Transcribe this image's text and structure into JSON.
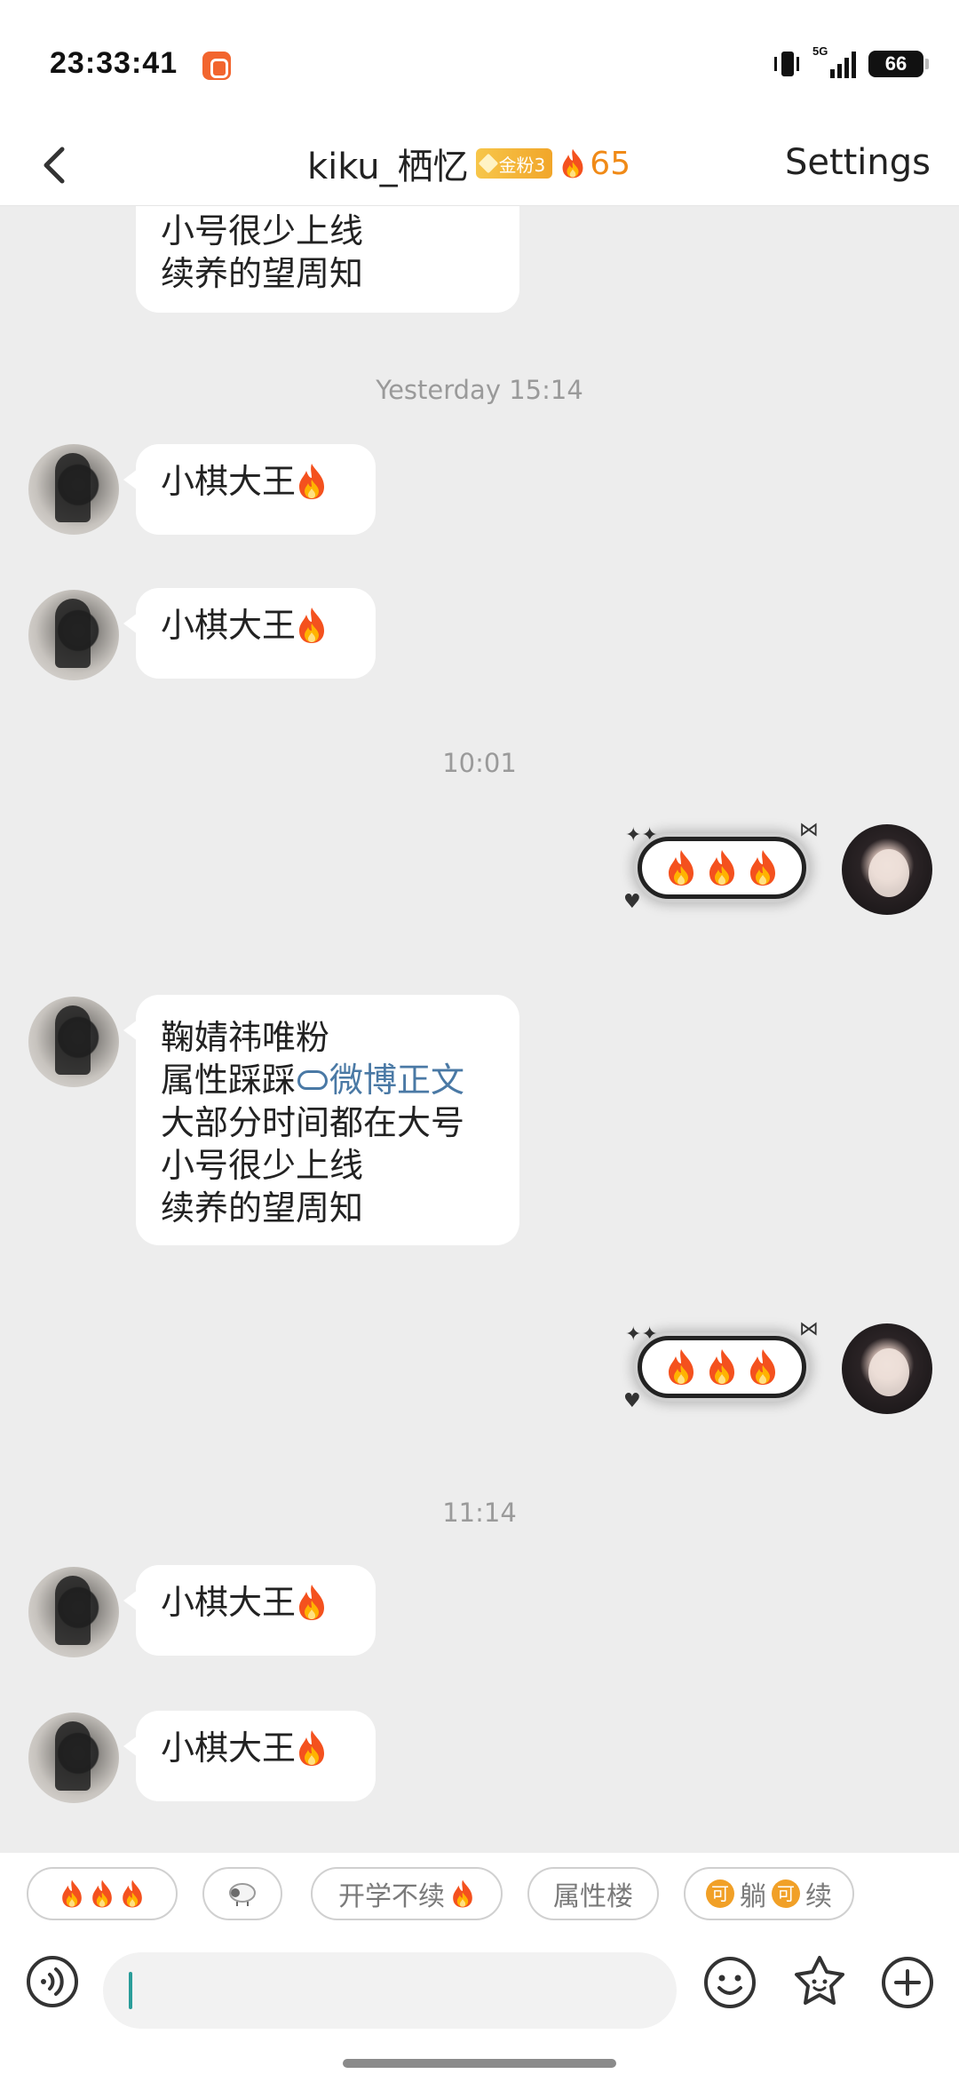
{
  "status_bar": {
    "time": "23:33:41",
    "network": "5G",
    "battery": "66"
  },
  "header": {
    "title": "kiku_栖忆",
    "fan_badge": "金粉3",
    "fire_score": "65",
    "settings_label": "Settings"
  },
  "messages": {
    "top_partial": {
      "line1": "小号很少上线",
      "line2": "续养的望周知"
    },
    "ts1": "Yesterday 15:14",
    "m1": "小棋大王",
    "m2": "小棋大王",
    "ts2": "10:01",
    "m4": {
      "line1": "鞠婧祎唯粉",
      "line2_prefix": "属性踩踩",
      "line2_link": "微博正文",
      "line3": "大部分时间都在大号",
      "line4": "小号很少上线",
      "line5": "续养的望周知"
    },
    "ts3": "11:14",
    "m6": "小棋大王",
    "m7": "小棋大王"
  },
  "quick_replies": {
    "chip2_icon": "sheep-icon",
    "chip3": "开学不续",
    "chip4": "属性楼",
    "chip5_a": "可",
    "chip5_b": "躺",
    "chip5_c": "可",
    "chip5_d": "续"
  },
  "input": {
    "value": "",
    "placeholder": ""
  },
  "icons": {
    "back": "chevron-left-icon",
    "voice": "voice-icon",
    "emoji": "smiley-icon",
    "sticker": "sticker-icon",
    "plus": "plus-icon",
    "fire": "fire-icon"
  },
  "colors": {
    "accent_fire": "#f08a17",
    "link": "#4a79a5",
    "badge": "#f1a62a",
    "caret": "#2a9d9a"
  }
}
